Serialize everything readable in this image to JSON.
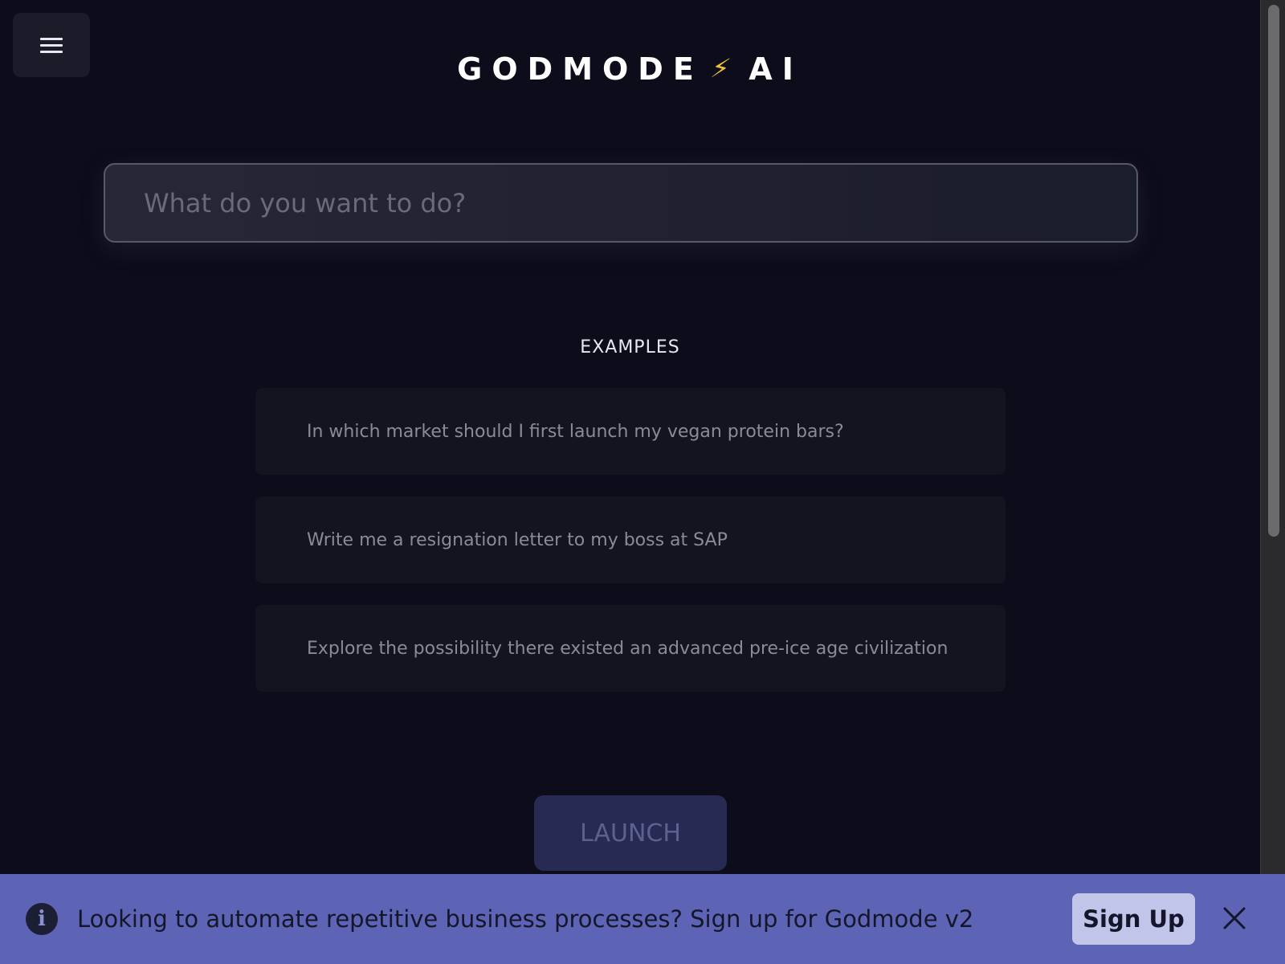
{
  "header": {
    "title_left": "GODMODE",
    "title_bolt": "⚡",
    "title_right": "AI",
    "menu_icon": "hamburger-menu-icon"
  },
  "search": {
    "placeholder": "What do you want to do?",
    "value": ""
  },
  "examples": {
    "heading": "EXAMPLES",
    "items": [
      {
        "label": "In which market should I first launch my vegan protein bars?"
      },
      {
        "label": "Write me a resignation letter to my boss at SAP"
      },
      {
        "label": "Explore the possibility there existed an advanced pre-ice age civilization"
      }
    ]
  },
  "launch": {
    "label": "LAUNCH"
  },
  "banner": {
    "info_icon_glyph": "i",
    "message": "Looking to automate repetitive business processes? Sign up for Godmode v2",
    "signup_label": "Sign Up",
    "close_icon": "close-icon"
  },
  "colors": {
    "background": "#0c0c1a",
    "banner": "#5d64b5",
    "signup_button": "#c2c5ea",
    "launch_button": "#272a52",
    "bolt": "#f2c230"
  }
}
